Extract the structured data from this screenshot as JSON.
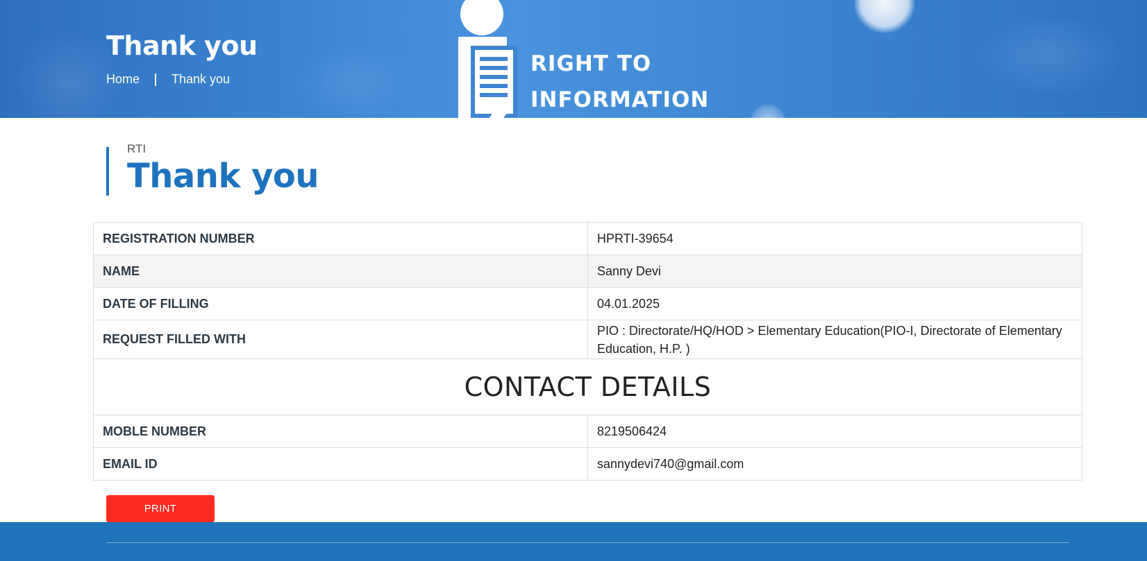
{
  "hero": {
    "title": "Thank you",
    "breadcrumb": [
      {
        "label": "Home"
      },
      {
        "label": "Thank you"
      }
    ],
    "logo_text": [
      "RIGHT TO",
      "INFORMATION"
    ]
  },
  "section": {
    "subtitle": "RTI",
    "title": "Thank you"
  },
  "details": {
    "registration": {
      "label": "REGISTRATION NUMBER",
      "value": "HPRTI-39654"
    },
    "name": {
      "label": "NAME",
      "value": "Sanny Devi"
    },
    "date": {
      "label": "DATE OF FILLING",
      "value": "04.01.2025"
    },
    "request": {
      "label": "REQUEST FILLED WITH",
      "value": "PIO : Directorate/HQ/HOD > Elementary Education(PIO-I, Directorate of Elementary Education, H.P. )"
    },
    "contact_heading": "CONTACT DETAILS",
    "mobile": {
      "label": "MOBLE NUMBER",
      "value": "8219506424"
    },
    "email": {
      "label": "EMAIL ID",
      "value": "sannydevi740@gmail.com"
    }
  },
  "actions": {
    "print_label": "PRINT",
    "print_color": "#ff2a20"
  },
  "colors": {
    "accent": "#1e73be",
    "footer": "#1f74bb"
  },
  "icons": {
    "logo": "rti-info-person-icon"
  }
}
